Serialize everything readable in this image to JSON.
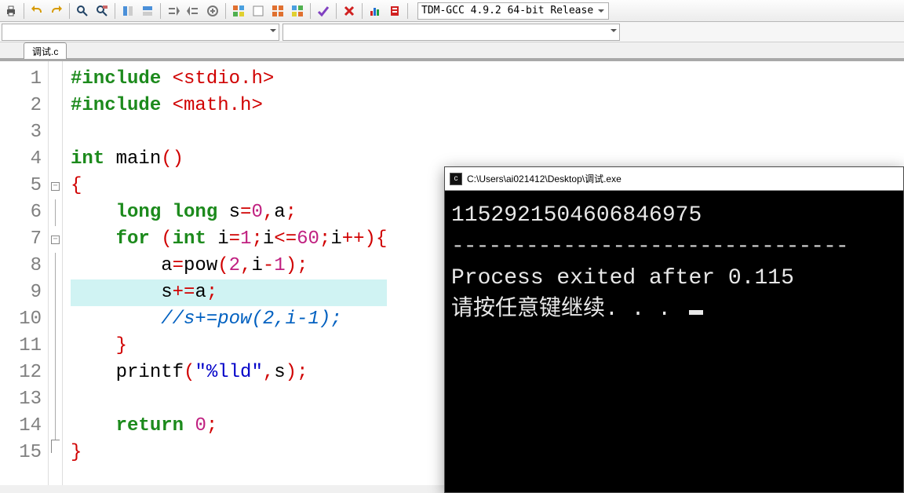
{
  "toolbar": {
    "compiler_selected": "TDM-GCC 4.9.2 64-bit Release"
  },
  "tab": {
    "label": "调试.c"
  },
  "code": {
    "lines": [
      {
        "n": "1",
        "tokens": [
          [
            "dir",
            "#include "
          ],
          [
            "inc",
            "<stdio.h>"
          ]
        ]
      },
      {
        "n": "2",
        "tokens": [
          [
            "dir",
            "#include "
          ],
          [
            "inc",
            "<math.h>"
          ]
        ]
      },
      {
        "n": "3",
        "tokens": [
          [
            "id",
            ""
          ]
        ]
      },
      {
        "n": "4",
        "tokens": [
          [
            "kw",
            "int"
          ],
          [
            "id",
            " "
          ],
          [
            "fn",
            "main"
          ],
          [
            "br",
            "()"
          ]
        ]
      },
      {
        "n": "5",
        "fold": "open",
        "tokens": [
          [
            "br",
            "{"
          ]
        ]
      },
      {
        "n": "6",
        "tokens": [
          [
            "id",
            "    "
          ],
          [
            "kw",
            "long long"
          ],
          [
            "id",
            " s"
          ],
          [
            "op",
            "="
          ],
          [
            "num",
            "0"
          ],
          [
            "op",
            ","
          ],
          [
            "id",
            "a"
          ],
          [
            "op",
            ";"
          ]
        ]
      },
      {
        "n": "7",
        "fold": "open",
        "tokens": [
          [
            "id",
            "    "
          ],
          [
            "kw",
            "for"
          ],
          [
            "id",
            " "
          ],
          [
            "br",
            "("
          ],
          [
            "kw",
            "int"
          ],
          [
            "id",
            " i"
          ],
          [
            "op",
            "="
          ],
          [
            "num",
            "1"
          ],
          [
            "op",
            ";"
          ],
          [
            "id",
            "i"
          ],
          [
            "op",
            "<="
          ],
          [
            "num",
            "60"
          ],
          [
            "op",
            ";"
          ],
          [
            "id",
            "i"
          ],
          [
            "op",
            "++"
          ],
          [
            "br",
            ")"
          ],
          [
            "br",
            "{"
          ]
        ]
      },
      {
        "n": "8",
        "tokens": [
          [
            "id",
            "        a"
          ],
          [
            "op",
            "="
          ],
          [
            "fn",
            "pow"
          ],
          [
            "br",
            "("
          ],
          [
            "num",
            "2"
          ],
          [
            "op",
            ","
          ],
          [
            "id",
            "i"
          ],
          [
            "op",
            "-"
          ],
          [
            "num",
            "1"
          ],
          [
            "br",
            ")"
          ],
          [
            "op",
            ";"
          ]
        ]
      },
      {
        "n": "9",
        "hl": true,
        "tokens": [
          [
            "id",
            "        s"
          ],
          [
            "op",
            "+="
          ],
          [
            "id",
            "a"
          ],
          [
            "op",
            ";"
          ]
        ]
      },
      {
        "n": "10",
        "tokens": [
          [
            "id",
            "        "
          ],
          [
            "cmt",
            "//s+=pow(2,i-1);"
          ]
        ]
      },
      {
        "n": "11",
        "tokens": [
          [
            "id",
            "    "
          ],
          [
            "br",
            "}"
          ]
        ]
      },
      {
        "n": "12",
        "tokens": [
          [
            "id",
            "    "
          ],
          [
            "fn",
            "printf"
          ],
          [
            "br",
            "("
          ],
          [
            "str",
            "\"%lld\""
          ],
          [
            "op",
            ","
          ],
          [
            "id",
            "s"
          ],
          [
            "br",
            ")"
          ],
          [
            "op",
            ";"
          ]
        ]
      },
      {
        "n": "13",
        "tokens": [
          [
            "id",
            ""
          ]
        ]
      },
      {
        "n": "14",
        "tokens": [
          [
            "id",
            "    "
          ],
          [
            "kw",
            "return"
          ],
          [
            "id",
            " "
          ],
          [
            "num",
            "0"
          ],
          [
            "op",
            ";"
          ]
        ]
      },
      {
        "n": "15",
        "fold": "end",
        "tokens": [
          [
            "br",
            "}"
          ]
        ]
      }
    ]
  },
  "console": {
    "title": "C:\\Users\\ai021412\\Desktop\\调试.exe",
    "out_number": "1152921504606846975",
    "out_exit": "Process exited after 0.115",
    "out_prompt": "请按任意键继续. . . "
  },
  "icons": {
    "print": "print-icon",
    "undo": "undo-icon",
    "redo": "redo-icon",
    "find": "find-icon",
    "replace": "replace-icon",
    "toggle1": "toggle-bookmark-icon",
    "toggle2": "goto-bookmark-icon",
    "indent": "indent-icon",
    "outdent": "outdent-icon",
    "wrap": "wrap-icon",
    "grid1": "compile-icon",
    "grid2": "run-icon",
    "grid3": "compilerun-icon",
    "grid4": "rebuild-icon",
    "check": "syntax-check-icon",
    "stop": "stop-icon",
    "chart": "profile-icon",
    "bug": "debug-icon"
  }
}
